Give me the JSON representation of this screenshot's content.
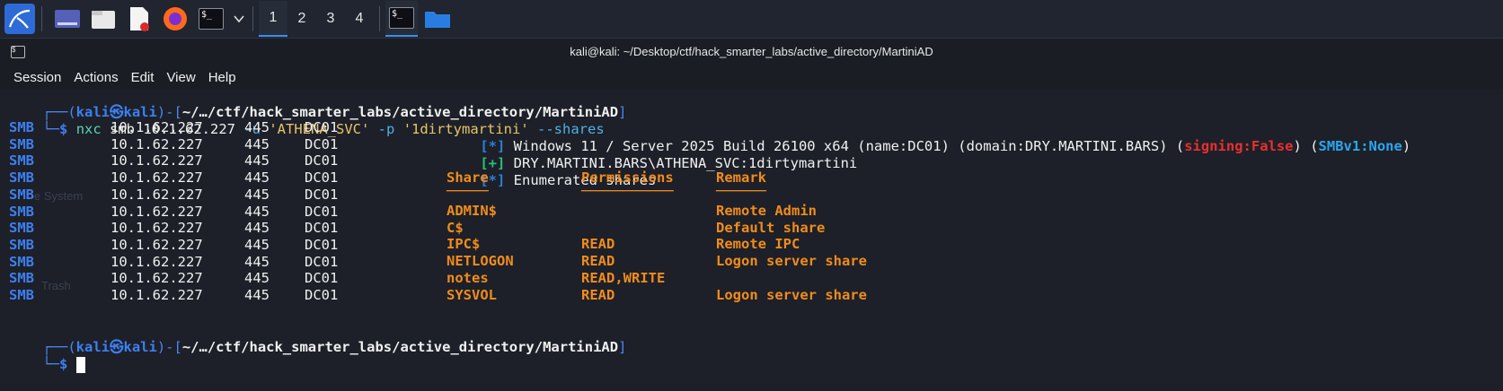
{
  "taskbar": {
    "workspaces": [
      "1",
      "2",
      "3",
      "4"
    ],
    "active_workspace": "1",
    "terminal_icon_text": "$_",
    "icons": [
      "kali-menu-icon",
      "show-desktop-icon",
      "file-manager-icon",
      "text-editor-icon",
      "firefox-icon",
      "terminal-icon",
      "chevron-down-icon",
      "terminal-task-icon",
      "folder-task-icon"
    ]
  },
  "window": {
    "title": "kali@kali: ~/Desktop/ctf/hack_smarter_labs/active_directory/MartiniAD",
    "menu": [
      "Session",
      "Actions",
      "Edit",
      "View",
      "Help"
    ]
  },
  "terminal": {
    "prompt": {
      "user": "kali",
      "at": "㉿",
      "host": "kali",
      "path": "~/…/ctf/hack_smarter_labs/active_directory/MartiniAD",
      "symbol": "$"
    },
    "command": {
      "binary": "nxc",
      "args_plain": " smb 10.1.62.227 ",
      "flag_u": "-u",
      "user_arg": "'ATHENA_SVC'",
      "flag_p": "-p",
      "pass_arg": "'1dirtymartini'",
      "flag_shares": "--shares"
    },
    "rows": [
      {
        "proto": "SMB",
        "ip": "10.1.62.227",
        "port": "445",
        "host": "DC01"
      },
      {
        "proto": "SMB",
        "ip": "10.1.62.227",
        "port": "445",
        "host": "DC01"
      },
      {
        "proto": "SMB",
        "ip": "10.1.62.227",
        "port": "445",
        "host": "DC01"
      },
      {
        "proto": "SMB",
        "ip": "10.1.62.227",
        "port": "445",
        "host": "DC01"
      },
      {
        "proto": "SMB",
        "ip": "10.1.62.227",
        "port": "445",
        "host": "DC01"
      },
      {
        "proto": "SMB",
        "ip": "10.1.62.227",
        "port": "445",
        "host": "DC01"
      },
      {
        "proto": "SMB",
        "ip": "10.1.62.227",
        "port": "445",
        "host": "DC01"
      },
      {
        "proto": "SMB",
        "ip": "10.1.62.227",
        "port": "445",
        "host": "DC01"
      },
      {
        "proto": "SMB",
        "ip": "10.1.62.227",
        "port": "445",
        "host": "DC01"
      },
      {
        "proto": "SMB",
        "ip": "10.1.62.227",
        "port": "445",
        "host": "DC01"
      },
      {
        "proto": "SMB",
        "ip": "10.1.62.227",
        "port": "445",
        "host": "DC01"
      }
    ],
    "info_line": {
      "tag": "[*]",
      "text": " Windows 11 / Server 2025 Build 26100 x64 (name:DC01) (domain:DRY.MARTINI.BARS) (",
      "signing": "signing:False",
      "mid": ") (",
      "smbv1": "SMBv1:None",
      "end": ")"
    },
    "auth_line": {
      "tag": "[+]",
      "text": " DRY.MARTINI.BARS\\ATHENA_SVC:1dirtymartini"
    },
    "enum_line": {
      "tag": "[*]",
      "text": " Enumerated shares"
    },
    "share_headers": {
      "share": "Share",
      "permissions": "Permissions",
      "remark": "Remark"
    },
    "share_underlines": {
      "share": "─────",
      "permissions": "───────────",
      "remark": "──────"
    },
    "shares": [
      {
        "name": "ADMIN$",
        "permissions": "",
        "remark": "Remote Admin"
      },
      {
        "name": "C$",
        "permissions": "",
        "remark": "Default share"
      },
      {
        "name": "IPC$",
        "permissions": "READ",
        "remark": "Remote IPC"
      },
      {
        "name": "NETLOGON",
        "permissions": "READ",
        "remark": "Logon server share"
      },
      {
        "name": "notes",
        "permissions": "READ,WRITE",
        "remark": ""
      },
      {
        "name": "SYSVOL",
        "permissions": "READ",
        "remark": "Logon server share"
      }
    ],
    "background_ghost_text": [
      "e System",
      "Trash"
    ]
  },
  "colors": {
    "prompt_blue": "#3d7ff0",
    "smb_blue": "#3d7ff0",
    "orange": "#f08c1c",
    "signing_red": "#e83030",
    "smbv1_blue": "#2aa6f0",
    "success_green": "#28c07a",
    "background": "#1d2028"
  }
}
